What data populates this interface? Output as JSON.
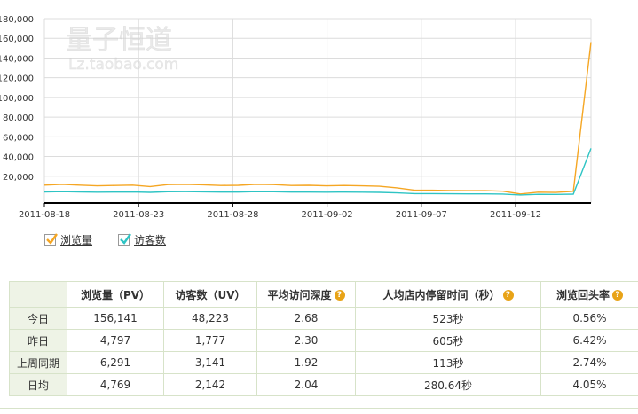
{
  "watermark": {
    "line1": "量子恒道",
    "line2": "Lz.taobao.com"
  },
  "chart_data": {
    "type": "line",
    "x": [
      "2011-08-18",
      "2011-08-19",
      "2011-08-20",
      "2011-08-21",
      "2011-08-22",
      "2011-08-23",
      "2011-08-24",
      "2011-08-25",
      "2011-08-26",
      "2011-08-27",
      "2011-08-28",
      "2011-08-29",
      "2011-08-30",
      "2011-08-31",
      "2011-09-01",
      "2011-09-02",
      "2011-09-03",
      "2011-09-04",
      "2011-09-05",
      "2011-09-06",
      "2011-09-07",
      "2011-09-08",
      "2011-09-09",
      "2011-09-10",
      "2011-09-11",
      "2011-09-12",
      "2011-09-13",
      "2011-09-14",
      "2011-09-15",
      "2011-09-16"
    ],
    "xticks": [
      "2011-08-18",
      "2011-08-23",
      "2011-08-28",
      "2011-09-02",
      "2011-09-07",
      "2011-09-12"
    ],
    "yticks": [
      "20,000",
      "40,000",
      "60,000",
      "80,000",
      "100,000",
      "120,000",
      "140,000",
      "160,000",
      "180,000"
    ],
    "ylim": [
      0,
      180000
    ],
    "grid": true,
    "series": [
      {
        "name": "浏览量",
        "color": "#f5a623",
        "values": [
          11000,
          11800,
          11000,
          10300,
          10600,
          11000,
          9500,
          11500,
          11800,
          11300,
          10600,
          10800,
          11800,
          11500,
          10600,
          10800,
          10300,
          10600,
          10300,
          9800,
          8200,
          5800,
          5800,
          5500,
          5300,
          5300,
          4800,
          2000,
          3800,
          3500,
          4700,
          156141
        ]
      },
      {
        "name": "访客数",
        "color": "#2ec4c4",
        "values": [
          4000,
          4300,
          4000,
          3800,
          3900,
          4000,
          3600,
          4200,
          4300,
          4100,
          3900,
          3900,
          4300,
          4200,
          3900,
          3900,
          3800,
          3900,
          3800,
          3600,
          3100,
          2300,
          2300,
          2200,
          2100,
          2100,
          1900,
          1000,
          1600,
          1500,
          1777,
          48223
        ]
      }
    ]
  },
  "legend": [
    {
      "label": "浏览量",
      "color": "#f5a623"
    },
    {
      "label": "访客数",
      "color": "#2ec4c4"
    }
  ],
  "table": {
    "headers": [
      "",
      "浏览量（PV）",
      "访客数（UV）",
      "平均访问深度",
      "人均店内停留时间（秒）",
      "浏览回头率"
    ],
    "rows": [
      [
        "今日",
        "156,141",
        "48,223",
        "2.68",
        "523秒",
        "0.56%"
      ],
      [
        "昨日",
        "4,797",
        "1,777",
        "2.30",
        "605秒",
        "6.42%"
      ],
      [
        "上周同期",
        "6,291",
        "3,141",
        "1.92",
        "113秒",
        "2.74%"
      ],
      [
        "日均",
        "4,769",
        "2,142",
        "2.04",
        "280.64秒",
        "4.05%"
      ]
    ]
  }
}
